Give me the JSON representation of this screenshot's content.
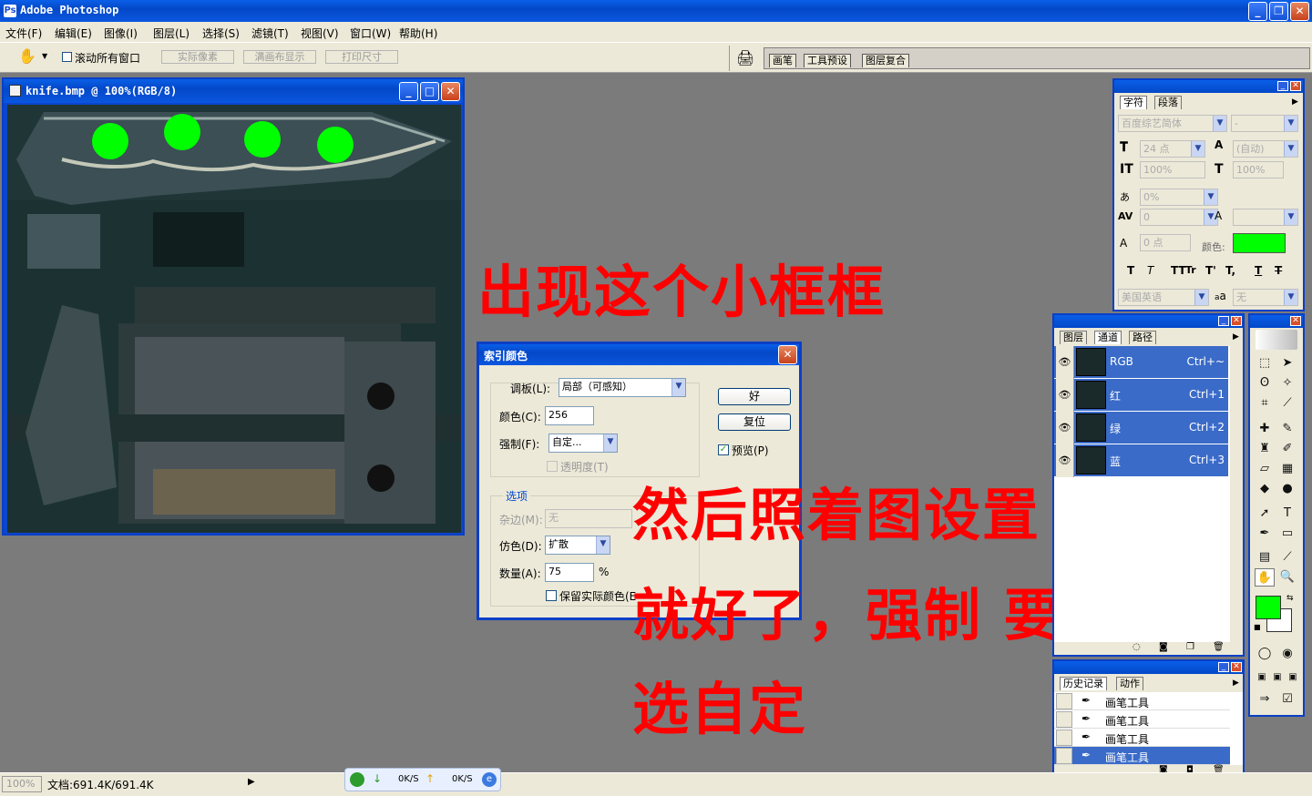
{
  "app": {
    "title": "Adobe Photoshop"
  },
  "menu": [
    "文件(F)",
    "编辑(E)",
    "图像(I)",
    "图层(L)",
    "选择(S)",
    "滤镜(T)",
    "视图(V)",
    "窗口(W)",
    "帮助(H)"
  ],
  "options_bar": {
    "scroll_all": "滚动所有窗口",
    "actual_pixels": "实际像素",
    "fit_screen": "满画布显示",
    "print_size": "打印尺寸"
  },
  "palette_well": {
    "tabs": [
      "画笔",
      "工具预设",
      "图层复合"
    ]
  },
  "document": {
    "title": "knife.bmp @ 100%(RGB/8)"
  },
  "annotations": {
    "line1": "出现这个小框框",
    "line2": "然后照着图设置",
    "line3": "就好了，强制 要",
    "line4": "选自定"
  },
  "dialog": {
    "title": "索引颜色",
    "palette_label": "调板(L):",
    "palette_value": "局部（可感知）",
    "colors_label": "颜色(C):",
    "colors_value": "256",
    "forced_label": "强制(F):",
    "forced_value": "自定...",
    "transparency_label": "透明度(T)",
    "options_group": "选项",
    "matte_label": "杂边(M):",
    "matte_value": "无",
    "dither_label": "仿色(D):",
    "dither_value": "扩散",
    "amount_label": "数量(A):",
    "amount_value": "75",
    "amount_unit": "%",
    "preserve_label": "保留实际颜色(E",
    "ok": "好",
    "reset": "复位",
    "preview": "预览(P)",
    "preview_checked": true
  },
  "char_panel": {
    "tabs": [
      "字符",
      "段落"
    ],
    "font": "百度综艺简体",
    "style": "-",
    "size": "24 点",
    "leading": "(自动)",
    "vscale": "100%",
    "hscale": "100%",
    "tsume": "0%",
    "kerning": "0",
    "baseline": "0 点",
    "color_label": "颜色:",
    "color": "#00ff00",
    "language": "美国英语",
    "aa_label": "a",
    "aa_value": "无",
    "styles": [
      "T",
      "T",
      "TT",
      "Tr",
      "T'",
      "T,",
      "T",
      "T"
    ]
  },
  "layers_panel": {
    "tabs": [
      "图层",
      "通道",
      "路径"
    ],
    "channels": [
      {
        "name": "RGB",
        "shortcut": "Ctrl+~"
      },
      {
        "name": "红",
        "shortcut": "Ctrl+1"
      },
      {
        "name": "绿",
        "shortcut": "Ctrl+2"
      },
      {
        "name": "蓝",
        "shortcut": "Ctrl+3"
      }
    ]
  },
  "history_panel": {
    "tabs": [
      "历史记录",
      "动作"
    ],
    "items": [
      "画笔工具",
      "画笔工具",
      "画笔工具",
      "画笔工具"
    ]
  },
  "toolbox": {
    "foreground": "#00ff00",
    "background": "#ffffff"
  },
  "statusbar": {
    "zoom": "100%",
    "doc_info": "文档:691.4K/691.4K",
    "down_speed": "0K/S",
    "up_speed": "0K/S"
  }
}
